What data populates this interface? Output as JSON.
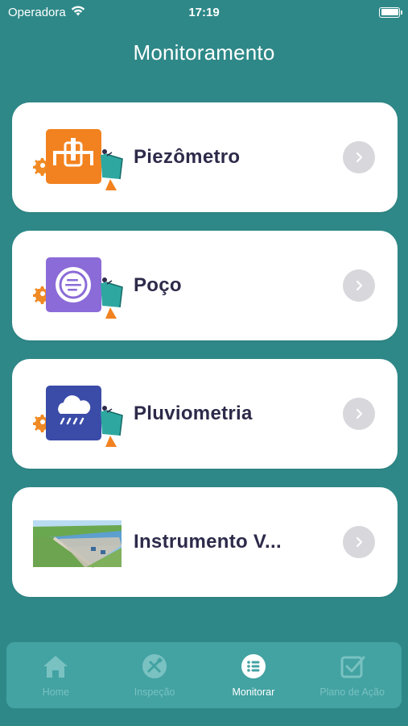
{
  "status_bar": {
    "carrier": "Operadora",
    "time": "17:19"
  },
  "header": {
    "title": "Monitoramento"
  },
  "items": [
    {
      "label": "Piezômetro",
      "icon": "piezometer-icon",
      "color": "#f2821f"
    },
    {
      "label": "Poço",
      "icon": "well-icon",
      "color": "#8b6bd8"
    },
    {
      "label": "Pluviometria",
      "icon": "rain-cloud-icon",
      "color": "#3b4ba8"
    },
    {
      "label": "Instrumento V...",
      "icon": "dam-photo",
      "color": "#6da44f"
    }
  ],
  "tabbar": {
    "tabs": [
      {
        "label": "Home",
        "icon": "home-icon",
        "active": false
      },
      {
        "label": "Inspeção",
        "icon": "inspection-icon",
        "active": false
      },
      {
        "label": "Monitorar",
        "icon": "list-icon",
        "active": true
      },
      {
        "label": "Plano de Ação",
        "icon": "checkbox-icon",
        "active": false
      }
    ]
  },
  "colors": {
    "background": "#2f8888",
    "card": "#ffffff",
    "tabbar": "#43a2a2",
    "text_dark": "#2d2a4a"
  }
}
